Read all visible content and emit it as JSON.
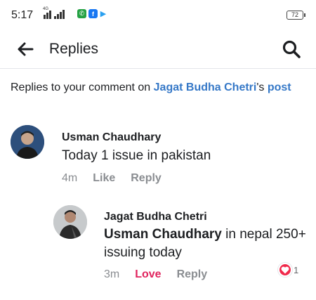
{
  "status_bar": {
    "time": "5:17",
    "network": "4G",
    "battery": "72",
    "apps": [
      "whatsapp-icon",
      "facebook-icon",
      "play-icon"
    ]
  },
  "header": {
    "title": "Replies"
  },
  "intro": {
    "prefix": "Replies to your comment on ",
    "author_link": "Jagat Budha Chetri",
    "possessive": "'s",
    "post_link": "post"
  },
  "comments": [
    {
      "author": "Usman Chaudhary",
      "text": "Today 1 issue in pakistan",
      "time": "4m",
      "like_label": "Like",
      "reply_label": "Reply"
    },
    {
      "author": "Jagat Budha Chetri",
      "mention": "Usman Chaudhary",
      "text": " in nepal 250+ issuing today",
      "time": "3m",
      "reaction_label": "Love",
      "reply_label": "Reply",
      "reaction_count": "1"
    }
  ],
  "colors": {
    "link": "#3578c7",
    "love": "#e0245e",
    "muted": "#8a8d91"
  }
}
